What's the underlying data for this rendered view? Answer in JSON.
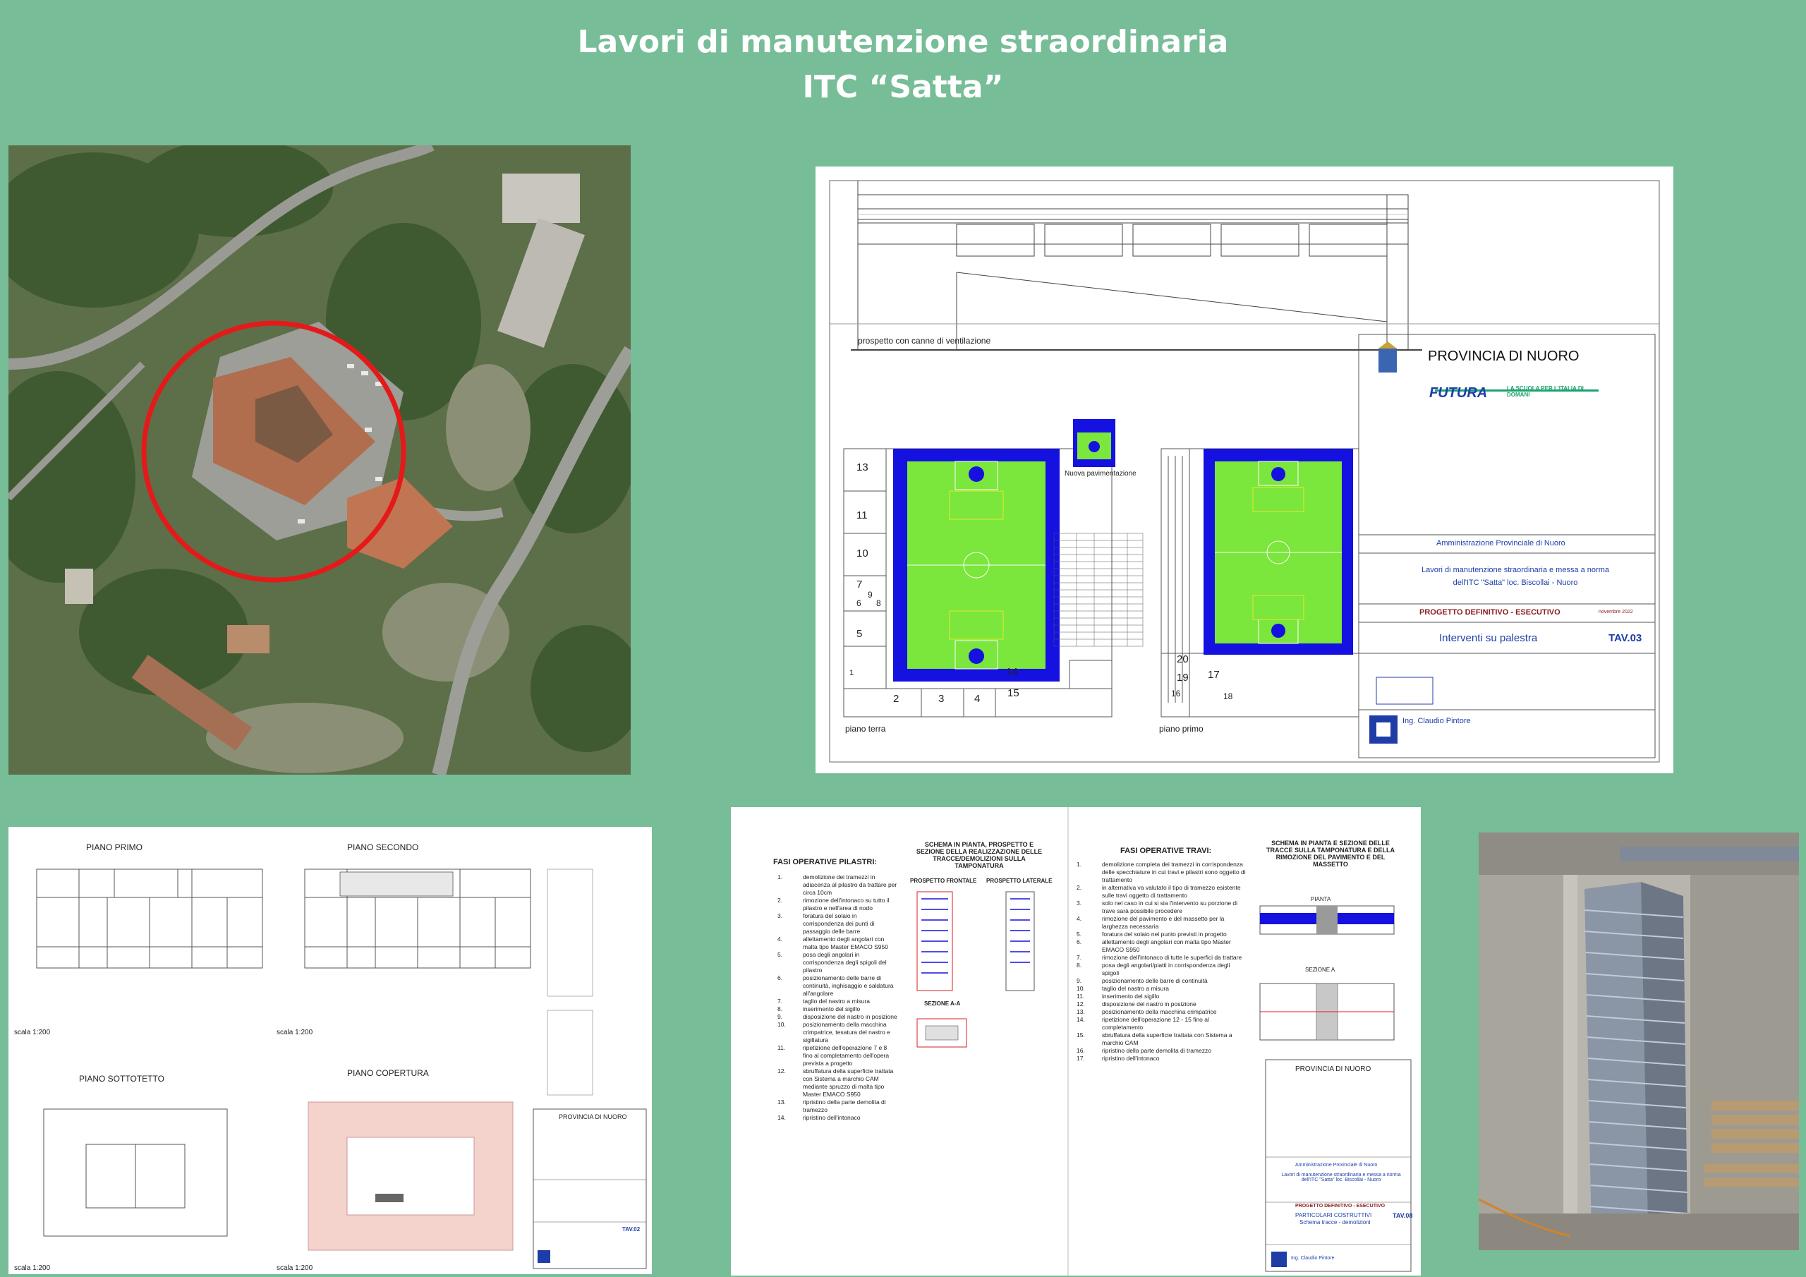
{
  "title": {
    "line1": "Lavori di manutenzione straordinaria",
    "line2": "ITC “Satta”"
  },
  "palette": {
    "background": "#77bd98",
    "circle": "#e41a1a",
    "court_blue": "#1511e0",
    "court_green": "#7be63c",
    "roof_pink": "#f3d3cc"
  },
  "sheet_palestra": {
    "elevation_label": "prospetto con canne di ventilazione",
    "legend_label": "Nuova pavimentazione",
    "plan_left_label": "piano terra",
    "plan_right_label": "piano primo",
    "room_numbers_left": [
      "13",
      "11",
      "10",
      "7",
      "6",
      "9",
      "8",
      "5",
      "2",
      "3",
      "4",
      "14",
      "15",
      "1"
    ],
    "room_numbers_right": [
      "20",
      "19",
      "16",
      "17",
      "18"
    ],
    "titleblock": {
      "ente": "PROVINCIA DI NUORO",
      "futura": "FUTURA",
      "futura_tag": "LA SCUOLA PER L'ITALIA DI DOMANI",
      "committente": "Amministrazione Provinciale di Nuoro",
      "progetto_line1": "Lavori di manutenzione straordinaria e messa a norma",
      "progetto_line2": "dell'ITC \"Satta\" loc. Biscollai - Nuoro",
      "fase": "PROGETTO DEFINITIVO - ESECUTIVO",
      "data": "novembre 2022",
      "allegato": "Interventi su palestra",
      "tavola": "TAV.03",
      "studio": "Ing. Claudio Pintore"
    }
  },
  "sheet_piante": {
    "labels": {
      "piano_primo": "PIANO PRIMO",
      "piano_secondo": "PIANO SECONDO",
      "piano_sottotetto": "PIANO SOTTOTETTO",
      "piano_copertura": "PIANO COPERTURA",
      "scala": "scala 1:200"
    },
    "titleblock": {
      "ente": "PROVINCIA DI NUORO",
      "tavola": "TAV.02"
    }
  },
  "sheet_fasi": {
    "pilastri": {
      "heading": "FASI OPERATIVE PILASTRI:",
      "items": [
        {
          "n": "1.",
          "t": "demolizione dei tramezzi in adiacenza al pilastro da trattare per circa 10cm"
        },
        {
          "n": "2.",
          "t": "rimozione dell'intonaco su tutto il pilastro e nell'area di nodo"
        },
        {
          "n": "3.",
          "t": "foratura del solaio in corrispondenza dei punti di passaggio delle barre"
        },
        {
          "n": "4.",
          "t": "allettamento degli angolari con malta tipo Master EMACO S950"
        },
        {
          "n": "5.",
          "t": "posa degli angolari in corrispondenza degli spigoli del pilastro"
        },
        {
          "n": "6.",
          "t": "posizionamento delle barre di continuità, inghisaggio e saldatura all'angolare"
        },
        {
          "n": "7.",
          "t": "taglio del nastro a misura"
        },
        {
          "n": "8.",
          "t": "inserimento del sigillo"
        },
        {
          "n": "9.",
          "t": "disposizione del nastro in posizione"
        },
        {
          "n": "10.",
          "t": "posizionamento della macchina crimpatrice, tesatura del nastro e sigillatura"
        },
        {
          "n": "11.",
          "t": "ripetizione dell'operazione 7 e 8 fino al completamento dell'opera prevista a progetto"
        },
        {
          "n": "12.",
          "t": "sbruffatura della superficie trattata con Sistema a marchio CAM mediante spruzzo di malta tipo Master EMACO S950"
        },
        {
          "n": "13.",
          "t": "ripristino della parte demolita di tramezzo"
        },
        {
          "n": "14.",
          "t": "ripristino dell'intonaco"
        }
      ]
    },
    "schema_pilastri_title": "SCHEMA IN PIANTA, PROSPETTO E SEZIONE DELLA REALIZZAZIONE DELLE TRACCE/DEMOLIZIONI SULLA TAMPONATURA",
    "prospetto_frontale": "PROSPETTO FRONTALE",
    "prospetto_laterale": "PROSPETTO LATERALE",
    "sezione_aa": "SEZIONE A-A",
    "travi": {
      "heading": "FASI OPERATIVE TRAVI:",
      "items": [
        {
          "n": "1.",
          "t": "demolizione completa dei tramezzi in corrispondenza delle specchiature in cui travi e pilastri sono oggetto di trattamento"
        },
        {
          "n": "2.",
          "t": "in alternativa va valutato il tipo di tramezzo esistente sulle travi oggetto di trattamento"
        },
        {
          "n": "3.",
          "t": "solo nel caso in cui si sia l'intervento su porzione di trave sarà possibile procedere"
        },
        {
          "n": "4.",
          "t": "rimozione del pavimento e del massetto per la larghezza necessaria"
        },
        {
          "n": "5.",
          "t": "foratura del solaio nei punto previsti in progetto"
        },
        {
          "n": "6.",
          "t": "allettamento degli angolari con malta tipo Master EMACO S950"
        },
        {
          "n": "7.",
          "t": "rimozione dell'intonaco di tutte le superfici da trattare"
        },
        {
          "n": "8.",
          "t": "posa degli angolari/piatti in corrispondenza degli spigoli"
        },
        {
          "n": "9.",
          "t": "posizionamento delle barre di continuità"
        },
        {
          "n": "10.",
          "t": "taglio del nastro a misura"
        },
        {
          "n": "11.",
          "t": "inserimento del sigillo"
        },
        {
          "n": "12.",
          "t": "disposizione del nastro in posizione"
        },
        {
          "n": "13.",
          "t": "posizionamento della macchina crimpatrice"
        },
        {
          "n": "14.",
          "t": "ripetizione dell'operazione 12 - 15 fino al completamento"
        },
        {
          "n": "15.",
          "t": "sbruffatura della superficie trattata con Sistema a marchio CAM"
        },
        {
          "n": "16.",
          "t": "ripristino della parte demolita di tramezzo"
        },
        {
          "n": "17.",
          "t": "ripristino dell'intonaco"
        }
      ]
    },
    "schema_travi_title": "SCHEMA IN PIANTA E SEZIONE DELLE TRACCE SULLA TAMPONATURA E DELLA RIMOZIONE DEL PAVIMENTO E DEL MASSETTO",
    "pianta": "PIANTA",
    "sezione_a": "SEZIONE A",
    "titleblock": {
      "ente": "PROVINCIA DI NUORO",
      "committente": "Amministrazione Provinciale di Nuoro",
      "progetto": "Lavori di manutenzione straordinaria e messa a norma dell'ITC \"Satta\" loc. Biscollai - Nuoro",
      "fase": "PROGETTO DEFINITIVO - ESECUTIVO",
      "particolari": "PARTICOLARI COSTRUTTIVI",
      "schema": "Schema tracce - demolizioni",
      "tavola": "TAV.08",
      "studio": "Ing. Claudio Pintore"
    }
  }
}
